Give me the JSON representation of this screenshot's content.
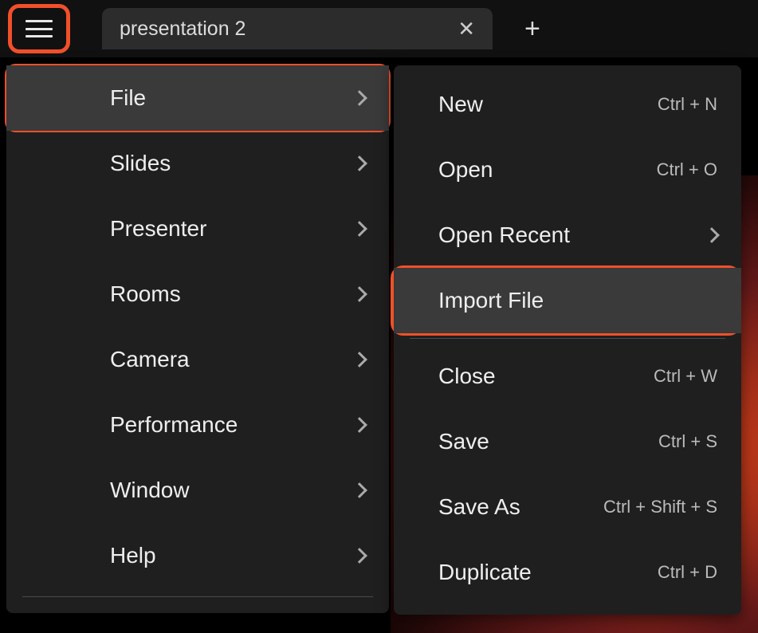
{
  "tab": {
    "title": "presentation 2"
  },
  "main_menu": {
    "items": [
      {
        "label": "File"
      },
      {
        "label": "Slides"
      },
      {
        "label": "Presenter"
      },
      {
        "label": "Rooms"
      },
      {
        "label": "Camera"
      },
      {
        "label": "Performance"
      },
      {
        "label": "Window"
      },
      {
        "label": "Help"
      }
    ]
  },
  "file_menu": {
    "items": [
      {
        "label": "New",
        "shortcut": "Ctrl + N"
      },
      {
        "label": "Open",
        "shortcut": "Ctrl + O"
      },
      {
        "label": "Open Recent",
        "shortcut": ""
      },
      {
        "label": "Import File",
        "shortcut": ""
      },
      {
        "label": "Close",
        "shortcut": "Ctrl + W"
      },
      {
        "label": "Save",
        "shortcut": "Ctrl + S"
      },
      {
        "label": "Save As",
        "shortcut": "Ctrl + Shift + S"
      },
      {
        "label": "Duplicate",
        "shortcut": "Ctrl + D"
      }
    ]
  }
}
